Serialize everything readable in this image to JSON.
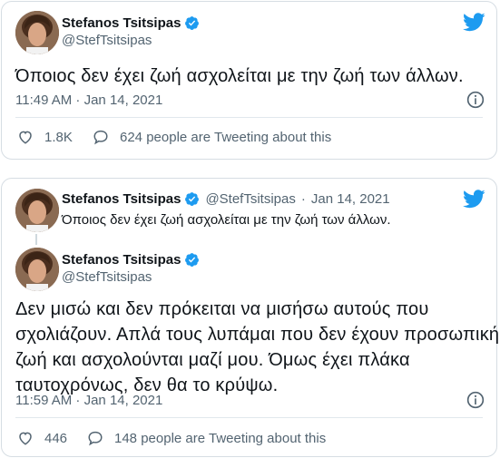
{
  "colors": {
    "accent": "#1d9bf0",
    "text": "#0f1419",
    "muted": "#536471",
    "border": "#e1e8ed"
  },
  "tweet1": {
    "name": "Stefanos Tsitsipas",
    "handle": "@StefTsitsipas",
    "text": "Όποιος δεν έχει ζωή ασχολείται με την ζωή των άλλων.",
    "timestamp": "11:49 AM · Jan 14, 2021",
    "likes": "1.8K",
    "tweeting_about": "624 people are Tweeting about this",
    "icons": [
      "twitter-bird-icon",
      "verified-badge-icon",
      "info-icon",
      "heart-icon",
      "reply-bubble-icon"
    ]
  },
  "tweet2": {
    "parent": {
      "name": "Stefanos Tsitsipas",
      "handle": "@StefTsitsipas",
      "separator": "·",
      "date": "Jan 14, 2021",
      "text": "Όποιος δεν έχει ζωή ασχολείται με την ζωή των άλλων."
    },
    "name": "Stefanos Tsitsipas",
    "handle": "@StefTsitsipas",
    "text_lines": [
      "Δεν μισώ και δεν πρόκειται να μισήσω αυτούς που",
      "σχολιάζουν. Απλά τους λυπάμαι που δεν έχουν προσωπική",
      "ζωή και ασχολούνται μαζί μου. Όμως έχει πλάκα",
      "ταυτοχρόνως, δεν θα το κρύψω."
    ],
    "timestamp": "11:59 AM · Jan 14, 2021",
    "likes": "446",
    "tweeting_about": "148 people are Tweeting about this"
  }
}
